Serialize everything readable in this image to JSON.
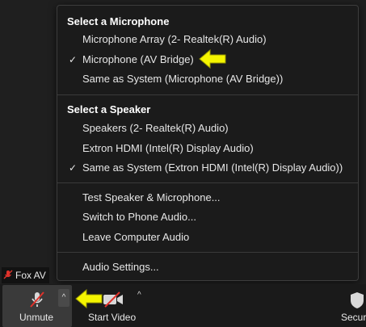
{
  "menu": {
    "microphone_header": "Select a Microphone",
    "microphones": [
      {
        "label": "Microphone Array (2- Realtek(R) Audio)",
        "checked": false
      },
      {
        "label": "Microphone (AV Bridge)",
        "checked": true
      },
      {
        "label": "Same as System (Microphone (AV Bridge))",
        "checked": false
      }
    ],
    "speaker_header": "Select a Speaker",
    "speakers": [
      {
        "label": "Speakers (2- Realtek(R) Audio)",
        "checked": false
      },
      {
        "label": "Extron HDMI (Intel(R) Display Audio)",
        "checked": false
      },
      {
        "label": "Same as System (Extron HDMI (Intel(R) Display Audio))",
        "checked": true
      }
    ],
    "actions": [
      "Test Speaker & Microphone...",
      "Switch to Phone Audio...",
      "Leave Computer Audio"
    ],
    "settings": "Audio Settings...",
    "check_glyph": "✓"
  },
  "participant_name": "Fox AV",
  "toolbar": {
    "unmute_label": "Unmute",
    "start_video_label": "Start Video",
    "security_label": "Secur"
  },
  "colors": {
    "highlight_arrow": "#f5f500",
    "muted_red": "#e0322b"
  }
}
